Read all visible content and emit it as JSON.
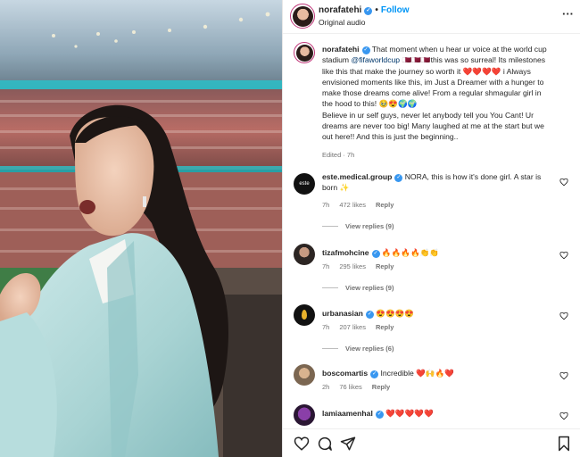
{
  "post": {
    "username": "norafatehi",
    "follow_label": "Follow",
    "audio": "Original audio",
    "caption_parts": {
      "p1": "That moment when u hear ur voice at the world cup stadium",
      "mention": "@fifaworldcup",
      "p2": "this was so surreal! Its milestones like this that make the journey so worth it",
      "p3": "i Always envisioned moments like this, im Just a Dreamer with a hunger to make those dreams come alive! From a regular shmagular girl in the hood to this!",
      "p4": "Believe in ur self guys, never let anybody tell you You Cant! Ur dreams are never too big! Many laughed at me at the start but we out here!! And this is just the beginning.."
    },
    "edited": "Edited · 7h"
  },
  "comments": [
    {
      "user": "este.medical.group",
      "text": "NORA, this is how it's done girl. A star is born ✨",
      "time": "7h",
      "likes": "472 likes",
      "reply": "Reply",
      "view_replies": "View replies (9)",
      "avatar_label": "este"
    },
    {
      "user": "tizafmohcine",
      "text": "🔥🔥🔥🔥👏👏",
      "time": "7h",
      "likes": "295 likes",
      "reply": "Reply",
      "view_replies": "View replies (9)"
    },
    {
      "user": "urbanasian",
      "text": "😍😍😍😍",
      "time": "7h",
      "likes": "207 likes",
      "reply": "Reply",
      "view_replies": "View replies (6)"
    },
    {
      "user": "boscomartis",
      "text": "Incredible ❤️🙌🔥❤️",
      "time": "2h",
      "likes": "76 likes",
      "reply": "Reply"
    },
    {
      "user": "lamiaamenhal",
      "text": "❤️❤️❤️❤️❤️"
    }
  ],
  "icons": {
    "like": "heart-icon",
    "comment": "comment-icon",
    "share": "send-icon",
    "save": "bookmark-icon",
    "more": "more-options-icon"
  },
  "colors": {
    "link": "#0095f6",
    "verified": "#3897f0",
    "muted": "#737373"
  }
}
